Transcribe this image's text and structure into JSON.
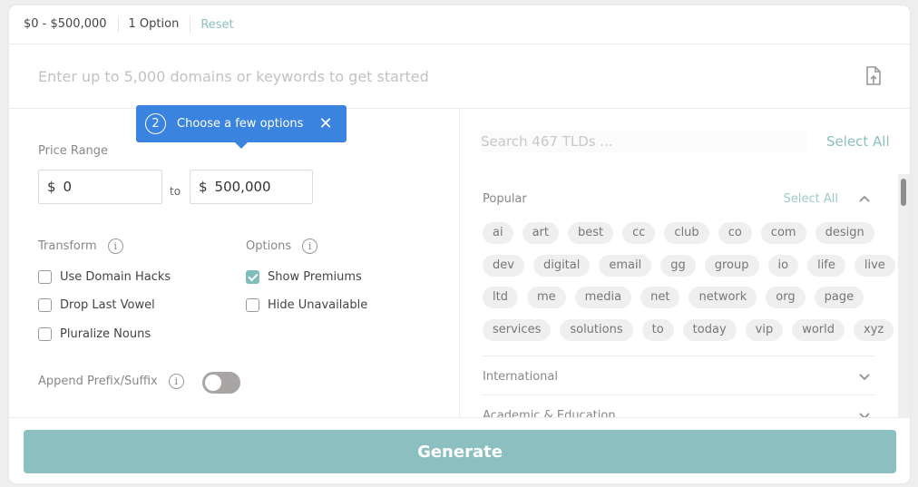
{
  "summary": {
    "price_range": "$0 - $500,000",
    "options_count": "1 Option",
    "reset_label": "Reset"
  },
  "keyword_input": {
    "placeholder": "Enter up to 5,000 domains or keywords to get started",
    "value": "",
    "upload_icon": "file-upload-icon"
  },
  "tooltip": {
    "step": "2",
    "text": "Choose a few options",
    "close_icon": "close-icon"
  },
  "price": {
    "label": "Price Range",
    "currency": "$",
    "min": "0",
    "max": "500,000",
    "to_label": "to"
  },
  "transform": {
    "label": "Transform",
    "items": [
      {
        "label": "Use Domain Hacks",
        "checked": false
      },
      {
        "label": "Drop Last Vowel",
        "checked": false
      },
      {
        "label": "Pluralize Nouns",
        "checked": false
      }
    ]
  },
  "options": {
    "label": "Options",
    "items": [
      {
        "label": "Show Premiums",
        "checked": true
      },
      {
        "label": "Hide Unavailable",
        "checked": false
      }
    ]
  },
  "append": {
    "label": "Append Prefix/Suffix",
    "enabled": false
  },
  "tlds": {
    "search_placeholder": "Search 467 TLDs ...",
    "select_all_label": "Select All",
    "categories": [
      {
        "name": "Popular",
        "select_all_label": "Select All",
        "expanded": true,
        "rows": [
          [
            "ai",
            "art",
            "best",
            "cc",
            "club",
            "co",
            "com",
            "design"
          ],
          [
            "dev",
            "digital",
            "email",
            "gg",
            "group",
            "io",
            "life",
            "live"
          ],
          [
            "ltd",
            "me",
            "media",
            "net",
            "network",
            "org",
            "page"
          ],
          [
            "services",
            "solutions",
            "to",
            "today",
            "vip",
            "world",
            "xyz"
          ]
        ]
      },
      {
        "name": "International",
        "expanded": false
      },
      {
        "name": "Academic & Education",
        "expanded": false
      }
    ]
  },
  "generate_label": "Generate",
  "colors": {
    "accent": "#8cc0c0",
    "tooltip": "#3a83de",
    "chip_bg": "#efefef"
  }
}
